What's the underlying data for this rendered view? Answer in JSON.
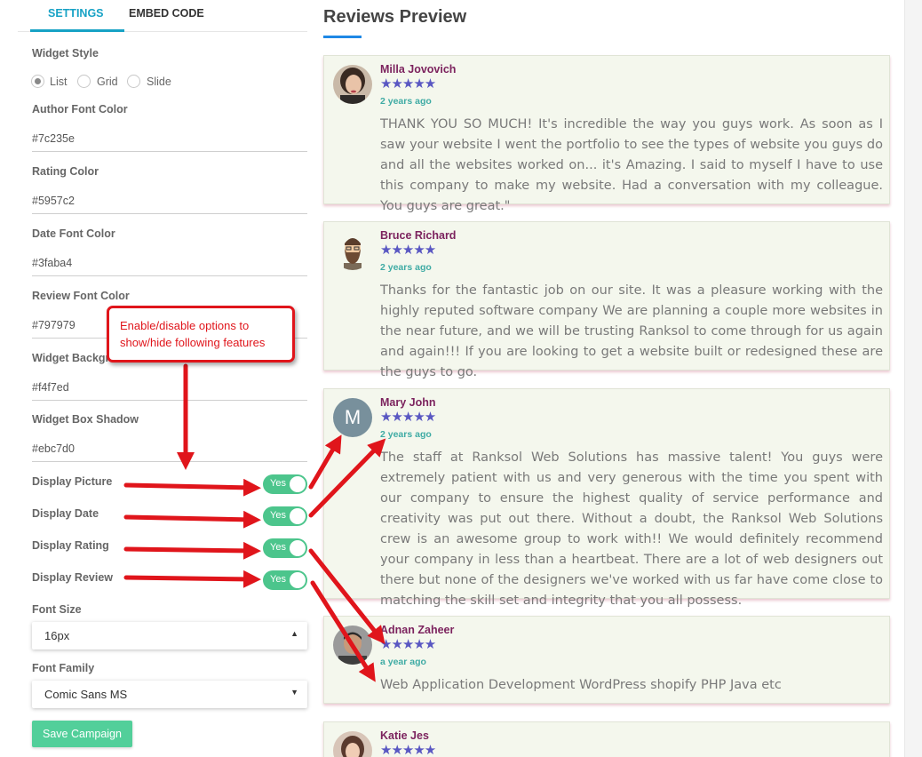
{
  "tabs": [
    {
      "label": "SETTINGS",
      "active": true
    },
    {
      "label": "EMBED CODE",
      "active": false
    }
  ],
  "settings": {
    "widget_style": {
      "label": "Widget Style",
      "options": [
        "List",
        "Grid",
        "Slide"
      ],
      "selected": "List"
    },
    "author_font_color": {
      "label": "Author Font Color",
      "value": "#7c235e"
    },
    "rating_color": {
      "label": "Rating Color",
      "value": "#5957c2"
    },
    "date_font_color": {
      "label": "Date Font Color",
      "value": "#3faba4"
    },
    "review_font_color": {
      "label": "Review Font Color",
      "value": "#797979"
    },
    "widget_background": {
      "label": "Widget Background",
      "label_visible": "Widget Backgr",
      "value": "#f4f7ed"
    },
    "widget_box_shadow": {
      "label": "Widget Box Shadow",
      "value": "#ebc7d0"
    },
    "display_picture": {
      "label": "Display Picture",
      "toggle": "Yes"
    },
    "display_date": {
      "label": "Display Date",
      "toggle": "Yes"
    },
    "display_rating": {
      "label": "Display Rating",
      "toggle": "Yes"
    },
    "display_review": {
      "label": "Display Review",
      "toggle": "Yes"
    },
    "font_size": {
      "label": "Font Size",
      "value": "16px"
    },
    "font_family": {
      "label": "Font Family",
      "value": "Comic Sans MS"
    },
    "save_label": "Save Campaign"
  },
  "annotation": {
    "text": "Enable/disable options to show/hide following features",
    "color": "#e0151b"
  },
  "preview": {
    "title": "Reviews Preview",
    "reviews": [
      {
        "author": "Milla Jovovich",
        "stars": "★★★★★",
        "rating": 5,
        "date": "2 years ago",
        "avatar": "photo-avatar",
        "text": "THANK YOU SO MUCH! It's incredible the way you guys work. As soon as I saw your website I went the portfolio to see the types of website you guys do and all the websites worked on... it's Amazing. I said to myself I have to use this company to make my website. Had a conversation with my colleague. You guys are great.\""
      },
      {
        "author": "Bruce Richard",
        "stars": "★★★★★",
        "rating": 5,
        "date": "2 years ago",
        "avatar": "cartoon-avatar",
        "text": "Thanks for the fantastic job on our site. It was a pleasure working with the highly reputed software company We are planning a couple more websites in the near future, and we will be trusting Ranksol to come through for us again and again!!! If you are looking to get a website built or redesigned these are the guys to go."
      },
      {
        "author": "Mary John",
        "stars": "★★★★★",
        "rating": 5,
        "date": "2 years ago",
        "avatar": "initial-avatar",
        "initial": "M",
        "text": "The staff at Ranksol Web Solutions has massive talent! You guys were extremely patient with us and very generous with the time you spent with our company to ensure the highest quality of service performance and creativity was put out there. Without a doubt, the Ranksol Web Solutions crew is an awesome group to work with!! We would definitely recommend your company in less than a heartbeat. There are a lot of web designers out there but none of the designers we've worked with us far have come close to matching the skill set and integrity that you all possess."
      },
      {
        "author": "Adnan Zaheer",
        "stars": "★★★★★",
        "rating": 5,
        "date": "a year ago",
        "avatar": "photo-avatar",
        "text": "Web Application Development WordPress shopify PHP Java etc"
      },
      {
        "author": "Katie Jes",
        "stars": "★★★★★",
        "rating": 5,
        "date": "",
        "avatar": "photo-avatar",
        "text": ""
      }
    ]
  },
  "colors": {
    "tab_accent": "#17a2c5",
    "toggle_on": "#4cc58c",
    "save_button": "#52cf9a",
    "title_accent": "#1e88e5"
  }
}
